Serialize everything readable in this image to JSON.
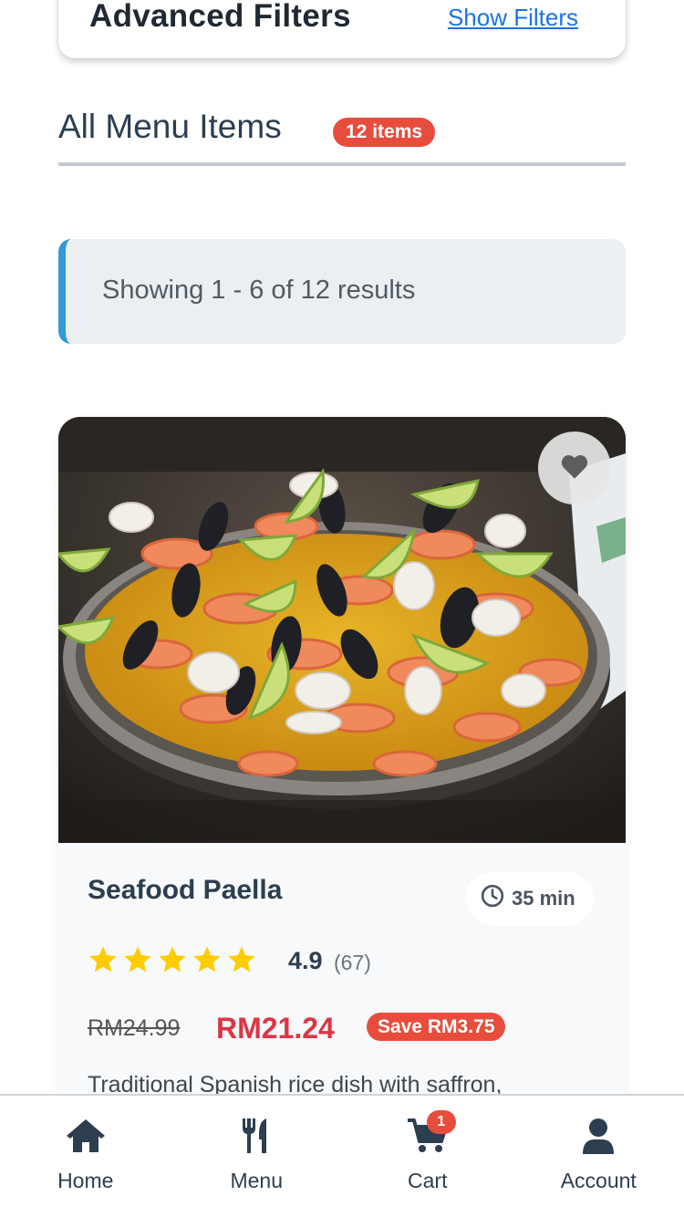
{
  "filters": {
    "title": "Advanced Filters",
    "toggle_label": "Show Filters"
  },
  "section": {
    "title": "All Menu Items",
    "count_badge": "12 items"
  },
  "results": {
    "text": "Showing 1 - 6 of 12 results"
  },
  "item": {
    "name": "Seafood Paella",
    "time": "35 min",
    "rating": "4.9",
    "reviews": "(67)",
    "stars": 5,
    "old_price": "RM24.99",
    "price": "RM21.24",
    "save_badge": "Save RM3.75",
    "description": "Traditional Spanish rice dish with saffron,",
    "favorite_icon": "heart-icon",
    "time_icon": "clock-icon"
  },
  "nav": {
    "items": [
      {
        "label": "Home",
        "icon": "home-icon"
      },
      {
        "label": "Menu",
        "icon": "utensils-icon"
      },
      {
        "label": "Cart",
        "icon": "cart-icon",
        "badge": "1"
      },
      {
        "label": "Account",
        "icon": "user-icon"
      }
    ]
  },
  "colors": {
    "accent_red": "#e74c3c",
    "price_red": "#dc3545",
    "info_blue": "#3498db",
    "link_blue": "#1a73e8",
    "star_yellow": "#ffcc00",
    "text_dark": "#2c3e50"
  }
}
